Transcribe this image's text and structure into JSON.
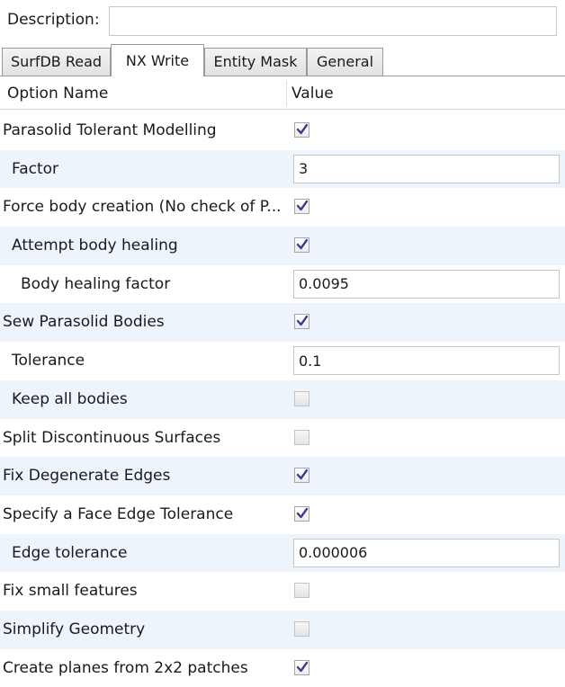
{
  "description": {
    "label": "Description:",
    "value": ""
  },
  "tabs": [
    {
      "label": "SurfDB Read",
      "active": false
    },
    {
      "label": "NX Write",
      "active": true
    },
    {
      "label": "Entity Mask",
      "active": false
    },
    {
      "label": "General",
      "active": false
    }
  ],
  "grid": {
    "col_option": "Option Name",
    "col_value": "Value"
  },
  "options": [
    {
      "name": "Parasolid Tolerant Modelling",
      "indent": 0,
      "type": "checkbox",
      "checked": true
    },
    {
      "name": "Factor",
      "indent": 1,
      "type": "text",
      "value": "3"
    },
    {
      "name": "Force body creation (No check of P...",
      "indent": 0,
      "type": "checkbox",
      "checked": true
    },
    {
      "name": "Attempt body healing",
      "indent": 1,
      "type": "checkbox",
      "checked": true
    },
    {
      "name": "Body healing factor",
      "indent": 2,
      "type": "text",
      "value": "0.0095"
    },
    {
      "name": "Sew Parasolid Bodies",
      "indent": 0,
      "type": "checkbox",
      "checked": true
    },
    {
      "name": "Tolerance",
      "indent": 1,
      "type": "text",
      "value": "0.1"
    },
    {
      "name": "Keep all bodies",
      "indent": 1,
      "type": "checkbox",
      "checked": false
    },
    {
      "name": "Split Discontinuous Surfaces",
      "indent": 0,
      "type": "checkbox",
      "checked": false
    },
    {
      "name": "Fix Degenerate Edges",
      "indent": 0,
      "type": "checkbox",
      "checked": true
    },
    {
      "name": "Specify a Face Edge Tolerance",
      "indent": 0,
      "type": "checkbox",
      "checked": true
    },
    {
      "name": "Edge tolerance",
      "indent": 1,
      "type": "text",
      "value": "0.000006"
    },
    {
      "name": "Fix small features",
      "indent": 0,
      "type": "checkbox",
      "checked": false
    },
    {
      "name": "Simplify Geometry",
      "indent": 0,
      "type": "checkbox",
      "checked": false
    },
    {
      "name": "Create planes from 2x2 patches",
      "indent": 0,
      "type": "checkbox",
      "checked": true
    }
  ],
  "colors": {
    "check_mark": "#3b3f8c",
    "alt_row": "#eef4fb"
  }
}
